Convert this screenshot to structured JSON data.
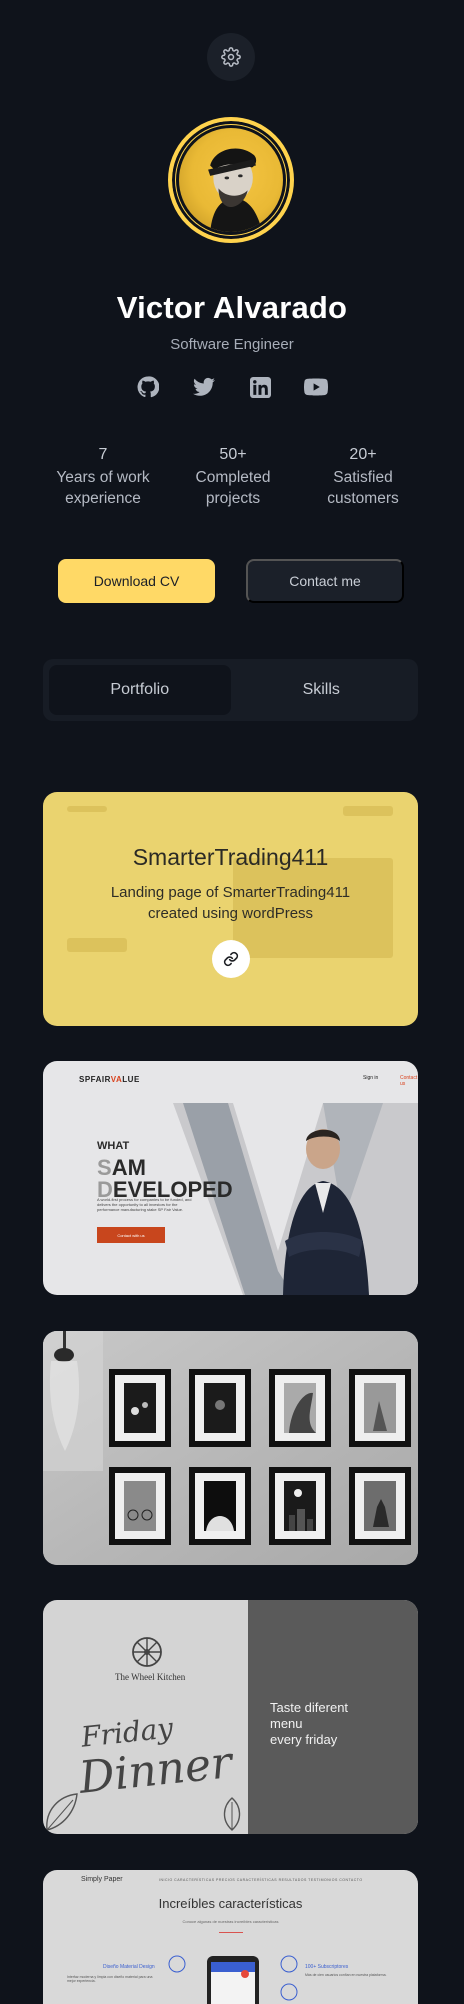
{
  "header": {
    "settings_icon": "gear-icon"
  },
  "profile": {
    "name": "Victor Alvarado",
    "role": "Software Engineer",
    "accent": "#ffd34d"
  },
  "socials": [
    {
      "icon": "github-icon"
    },
    {
      "icon": "twitter-icon"
    },
    {
      "icon": "linkedin-icon"
    },
    {
      "icon": "youtube-icon"
    }
  ],
  "stats": [
    {
      "value": "7",
      "label": "Years of work experience"
    },
    {
      "value": "50+",
      "label": "Completed projects"
    },
    {
      "value": "20+",
      "label": "Satisfied customers"
    }
  ],
  "actions": {
    "download_cv": "Download CV",
    "contact": "Contact me"
  },
  "tabs": [
    {
      "label": "Portfolio",
      "active": true
    },
    {
      "label": "Skills",
      "active": false
    }
  ],
  "projects": [
    {
      "title": "SmarterTrading411",
      "description": "Landing page of SmarterTrading411 created using wordPress",
      "link_icon": "link-icon",
      "overlay_color": "#ead36f"
    },
    {
      "brand": "SPFAIRVALUE",
      "brand_prefix": "SPFAIR",
      "brand_highlight": "VA",
      "brand_suffix": "LUE",
      "nav_sign": "Sign in",
      "nav_contact": "Contact us",
      "headline_1": "WHAT",
      "headline_2_fade": "S",
      "headline_2": "AM",
      "headline_3_fade": "D",
      "headline_3": "EVELOPED",
      "subtext": "A world-first process for companies to be funded, and delivers the opportunity to all investors for the performance manufacturing stake SP Fair Value.",
      "cta": "Contact with us"
    },
    {
      "theme": "framed-art-gallery"
    },
    {
      "logo": "The Wheel Kitchen",
      "script_1": "Friday",
      "script_2": "Dinner",
      "tagline_1": "Taste diferent",
      "tagline_2": "menu",
      "tagline_3": "every friday"
    },
    {
      "brand": "Simply Paper",
      "nav": "INICIO   CARACTERÍSTICAS   PRECIOS   CARACTERÍSTICAS   RESULTADOS   TESTIMONIOS   CONTACTO",
      "title": "Increíbles características",
      "subtitle": "Conoce algunas de nuestras increíbles características",
      "feature_left": "Diseño Material Design",
      "feature_left_desc": "Interfaz moderna y limpia con diseño material para una mejor experiencia.",
      "feature_right": "100+ Subscriptores",
      "feature_right_desc": "Más de cien usuarios confían en nuestra plataforma."
    }
  ]
}
